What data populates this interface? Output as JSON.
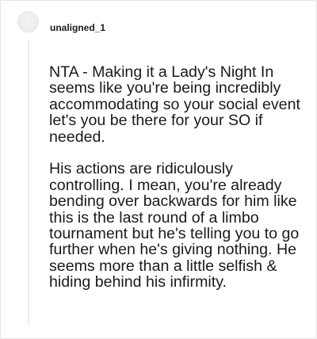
{
  "comment": {
    "username": "unaligned_1",
    "paragraphs": [
      "NTA - Making it a Lady's Night In seems like you're being incredibly accommodating so your social event let's you be there for your SO if needed.",
      "His actions are ridiculously controlling. I mean, you're already bending over backwards for him like this is the last round of a limbo tournament but he's telling you to go further when he's giving nothing. He seems more than a little selfish & hiding behind his infirmity."
    ]
  }
}
